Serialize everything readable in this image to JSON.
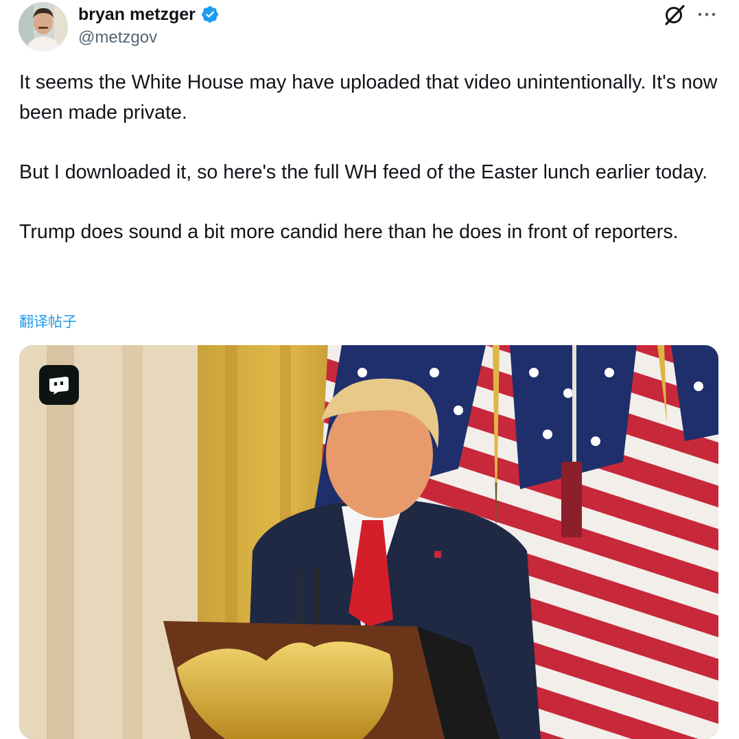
{
  "author": {
    "display_name": "bryan metzger",
    "handle": "@metzgov",
    "verified": true,
    "avatar_icon": "user-avatar"
  },
  "actions": {
    "grok_icon": "grok-icon",
    "more_icon": "more-options-icon"
  },
  "tweet": {
    "paragraphs": [
      "It seems the White House may have uploaded that video unintentionally. It's now been made private.",
      "But I downloaded it, so here's the full WH feed of the Easter lunch earlier today.",
      "Trump does sound a bit more candid here than he does in front of reporters."
    ],
    "translate_label": "翻译帖子"
  },
  "media": {
    "type": "video",
    "badge_icon": "video-source-badge-icon"
  },
  "colors": {
    "accent": "#1d9bf0",
    "text_primary": "#0f1419",
    "text_secondary": "#536471",
    "verified_badge": "#1d9bf0"
  }
}
